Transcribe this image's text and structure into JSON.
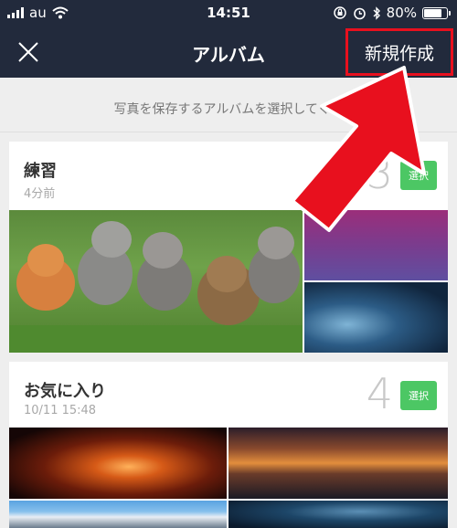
{
  "status_bar": {
    "carrier": "au",
    "time": "14:51",
    "battery_percent": "80%",
    "battery_level": 0.8,
    "icons": [
      "signal-icon",
      "wifi-icon",
      "orientation-lock-icon",
      "alarm-icon",
      "bluetooth-icon",
      "battery-icon"
    ]
  },
  "nav": {
    "title": "アルバム",
    "close_icon": "close-icon",
    "create_label": "新規作成",
    "highlight_color": "#e8101e"
  },
  "instruction": "写真を保存するアルバムを選択してくだ",
  "albums": [
    {
      "name": "練習",
      "date": "4分前",
      "count": "3",
      "select_label": "選択"
    },
    {
      "name": "お気に入り",
      "date": "10/11 15:48",
      "count": "4",
      "select_label": "選択"
    }
  ],
  "colors": {
    "header_bg": "#222a3c",
    "select_button": "#4cc764",
    "arrow": "#e8101e"
  }
}
